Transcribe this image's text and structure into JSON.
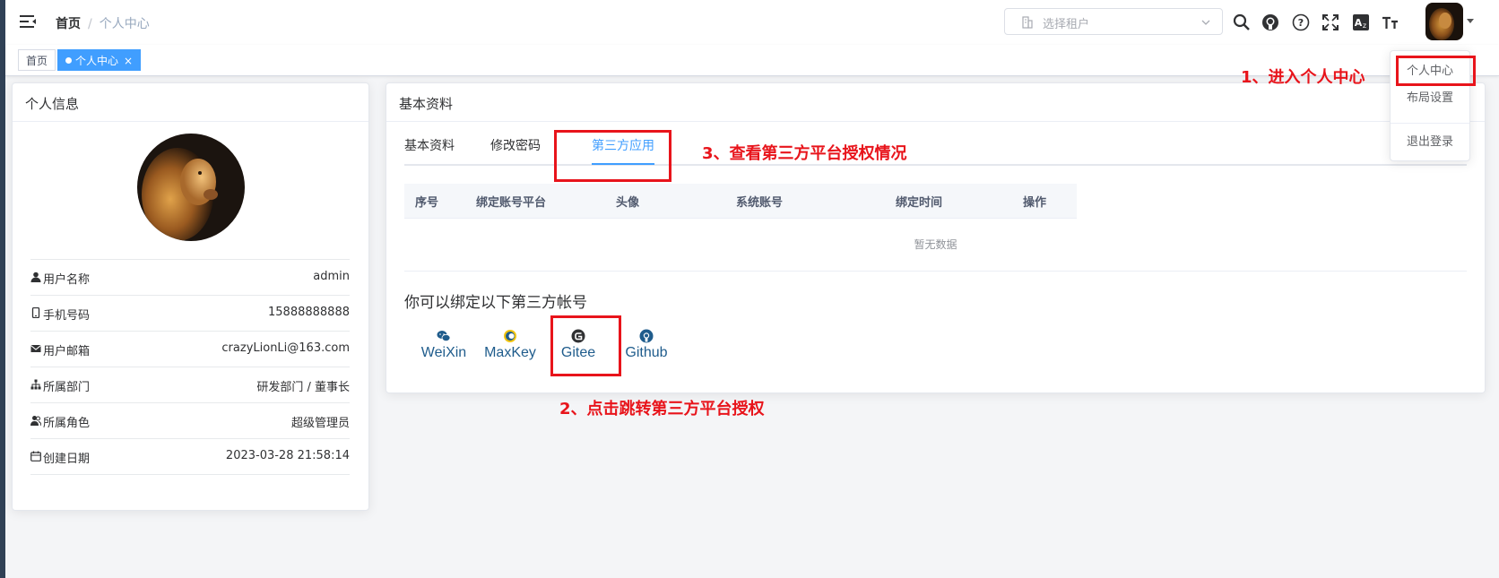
{
  "breadcrumb": {
    "home": "首页",
    "separator": "/",
    "current": "个人中心"
  },
  "header": {
    "tenant_placeholder": "选择租户",
    "icons": [
      "search-icon",
      "github-icon",
      "help-icon",
      "fullscreen-icon",
      "translate-icon",
      "font-size-icon"
    ]
  },
  "tags": {
    "home": "首页",
    "active": "个人中心",
    "close": "×"
  },
  "user_card": {
    "title": "个人信息",
    "fields": [
      {
        "icon": "user-icon",
        "label": "用户名称",
        "value": "admin"
      },
      {
        "icon": "phone-icon",
        "label": "手机号码",
        "value": "15888888888"
      },
      {
        "icon": "email-icon",
        "label": "用户邮箱",
        "value": "crazyLionLi@163.com"
      },
      {
        "icon": "tree-icon",
        "label": "所属部门",
        "value": "研发部门 / 董事长"
      },
      {
        "icon": "peoples-icon",
        "label": "所属角色",
        "value": "超级管理员"
      },
      {
        "icon": "date-icon",
        "label": "创建日期",
        "value": "2023-03-28 21:58:14"
      }
    ]
  },
  "basic_card": {
    "title": "基本资料",
    "tabs": [
      "基本资料",
      "修改密码",
      "第三方应用"
    ],
    "active_tab": "第三方应用",
    "table": {
      "columns": [
        "序号",
        "绑定账号平台",
        "头像",
        "系统账号",
        "绑定时间",
        "操作"
      ],
      "empty_text": "暂无数据"
    },
    "bind_title": "你可以绑定以下第三方帐号",
    "platforms": [
      {
        "icon": "wechat-icon",
        "label": "WeiXin"
      },
      {
        "icon": "maxkey-icon",
        "label": "MaxKey"
      },
      {
        "icon": "gitee-icon",
        "label": "Gitee"
      },
      {
        "icon": "github-icon",
        "label": "Github"
      }
    ]
  },
  "dropdown": {
    "items": [
      "个人中心",
      "布局设置",
      "退出登录"
    ]
  },
  "annotations": {
    "step1": "1、进入个人中心",
    "step2": "2、点击跳转第三方平台授权",
    "step3": "3、查看第三方平台授权情况"
  },
  "colors": {
    "primary": "#409eff",
    "annotation": "#e8141b",
    "sidebar": "#304156"
  }
}
